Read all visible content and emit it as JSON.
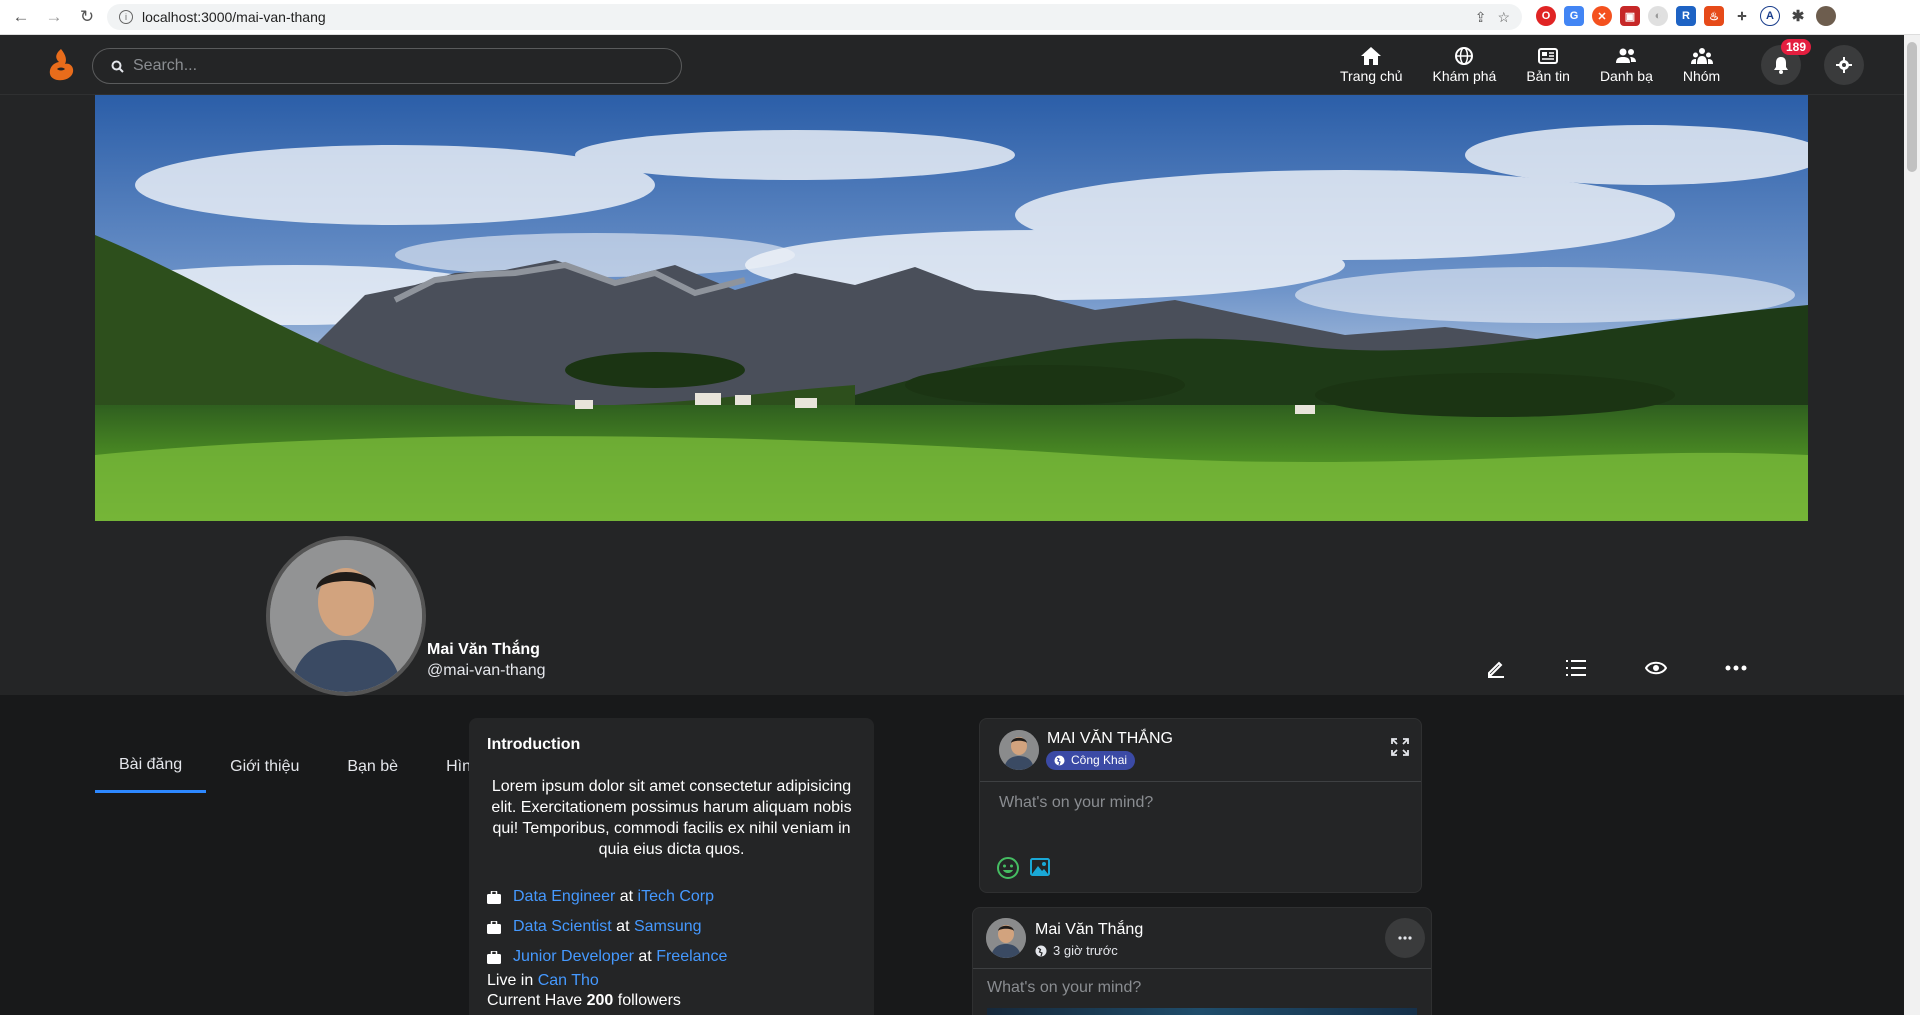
{
  "browser": {
    "url": "localhost:3000/mai-van-thang"
  },
  "header": {
    "search_placeholder": "Search...",
    "nav": [
      {
        "label": "Trang chủ",
        "icon": "home-icon"
      },
      {
        "label": "Khám phá",
        "icon": "globe-icon"
      },
      {
        "label": "Bản tin",
        "icon": "newspaper-icon"
      },
      {
        "label": "Danh bạ",
        "icon": "contacts-icon"
      },
      {
        "label": "Nhóm",
        "icon": "group-icon"
      }
    ],
    "notification_count": "189"
  },
  "profile": {
    "name": "Mai Văn Thắng",
    "handle": "@mai-van-thang",
    "tabs": [
      "Bài đăng",
      "Giới thiệu",
      "Bạn bè",
      "Hình ảnh"
    ],
    "active_tab": 0
  },
  "intro": {
    "title": "Introduction",
    "bio": "Lorem ipsum dolor sit amet consectetur adipisicing elit. Exercitationem possimus harum aliquam nobis qui! Temporibus, commodi facilis ex nihil veniam in quia eius dicta quos.",
    "jobs": [
      {
        "role": "Data Engineer",
        "at": "at",
        "company": "iTech Corp"
      },
      {
        "role": "Data Scientist",
        "at": "at",
        "company": "Samsung"
      },
      {
        "role": "Junior Developer",
        "at": "at",
        "company": "Freelance"
      }
    ],
    "live_prefix": "Live in",
    "live_place": "Can Tho",
    "followers_prefix": "Current Have",
    "followers_count": "200",
    "followers_suffix": "followers"
  },
  "composer": {
    "name": "MAI VĂN THẮNG",
    "privacy": "Công Khai",
    "placeholder": "What's on your mind?"
  },
  "post": {
    "name": "Mai Văn Thắng",
    "time": "3 giờ trước",
    "text": "What's on your mind?"
  },
  "colors": {
    "accent": "#2d88ff",
    "link": "#4599ff",
    "badge": "#e41e3f",
    "background": "#18191a",
    "surface": "#242526"
  }
}
